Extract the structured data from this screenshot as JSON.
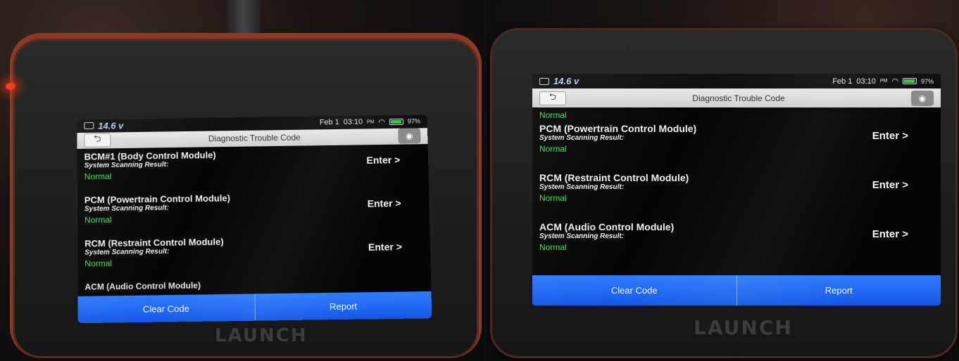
{
  "brand": "LAUNCH",
  "statusbar": {
    "voltage": "14.6",
    "voltage_unit": "v",
    "date": "Feb 1",
    "time": "03:10",
    "ampm": "PM",
    "battery": "97%"
  },
  "titlebar": {
    "title": "Diagnostic Trouble Code",
    "back_icon": "back-arrow-icon",
    "camera_icon": "camera-icon"
  },
  "result_label": "System Scanning Result:",
  "enter_label": "Enter >",
  "left_screen": {
    "modules": [
      {
        "name": "BCM#1 (Body Control Module)",
        "result": "Normal"
      },
      {
        "name": "PCM (Powertrain Control Module)",
        "result": "Normal"
      },
      {
        "name": "RCM (Restraint Control Module)",
        "result": "Normal"
      }
    ],
    "partial_next": "ACM (Audio Control Module)"
  },
  "right_screen": {
    "top_result": "Normal",
    "modules": [
      {
        "name": "PCM (Powertrain Control Module)",
        "result": "Normal"
      },
      {
        "name": "RCM (Restraint Control Module)",
        "result": "Normal"
      },
      {
        "name": "ACM (Audio Control Module)",
        "result": "Normal"
      }
    ]
  },
  "buttons": {
    "clear_code": "Clear Code",
    "report": "Report"
  },
  "colors": {
    "normal_green": "#35e04a",
    "button_blue": "#1f6bf5",
    "battery_green": "#27d13f"
  }
}
